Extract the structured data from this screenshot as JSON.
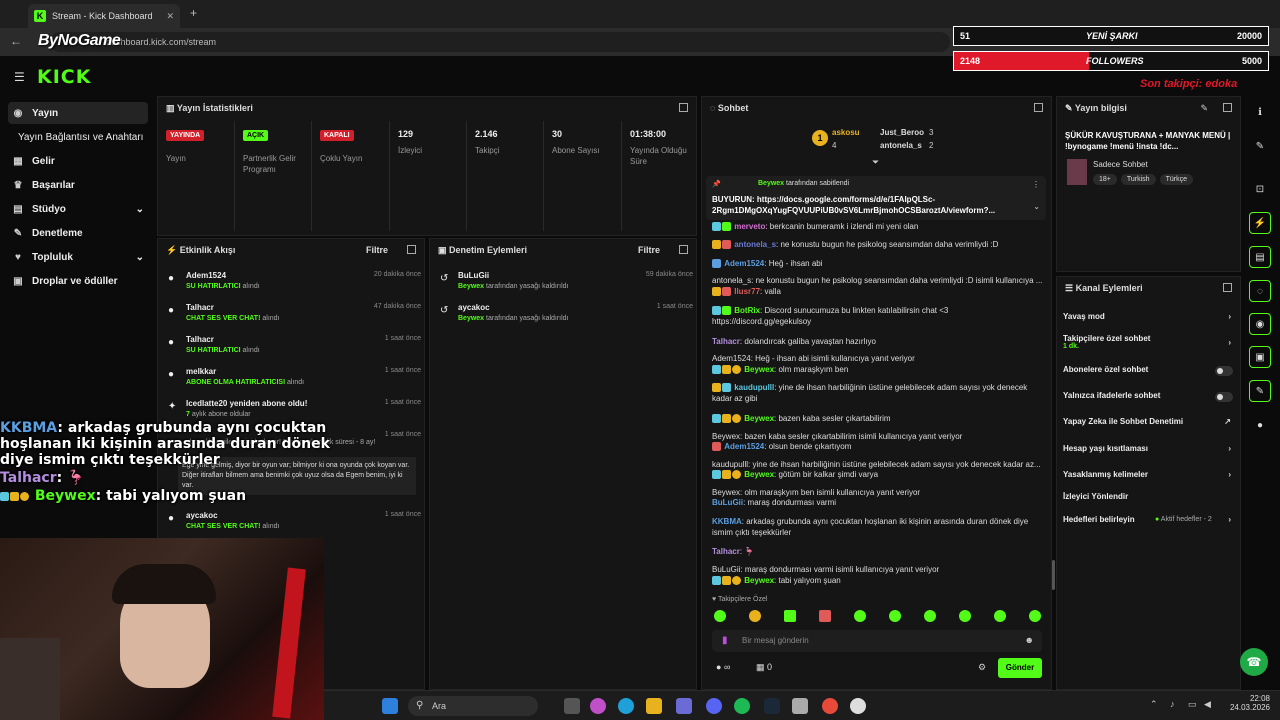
{
  "browser": {
    "tab_title": "Stream - Kick Dashboard",
    "url": "dashboard.kick.com/stream"
  },
  "kick": {
    "logo": "KICK"
  },
  "overlay": {
    "watermark": "ByNoGame",
    "song_current": "51",
    "song_label": "YENİ ŞARKI",
    "song_goal": "20000",
    "followers_current": "2148",
    "followers_label": "FOLLOWERS",
    "followers_goal": "5000",
    "followers_progress": 0.43,
    "last_follower": "Son takipçi: edoka",
    "accent": "#e0192a"
  },
  "sidebar": {
    "items": [
      {
        "label": "Yayın",
        "icon": "broadcast-icon"
      },
      {
        "label": "Yayın Bağlantısı ve Anahtarı",
        "icon": ""
      },
      {
        "label": "Gelir",
        "icon": "revenue-icon"
      },
      {
        "label": "Başarılar",
        "icon": "trophy-icon"
      },
      {
        "label": "Stüdyo",
        "icon": "studio-icon"
      },
      {
        "label": "Denetleme",
        "icon": "wrench-icon"
      },
      {
        "label": "Topluluk",
        "icon": "community-icon"
      },
      {
        "label": "Droplar ve ödüller",
        "icon": "drops-icon"
      }
    ]
  },
  "stats": {
    "title": "Yayın İstatistikleri",
    "cells": [
      {
        "badge": "YAYINDA",
        "label": "Yayın"
      },
      {
        "badge": "AÇIK",
        "label": "Partnerlik Gelir Programı"
      },
      {
        "badge": "KAPALI",
        "label": "Çoklu Yayın"
      },
      {
        "value": "129",
        "label": "İzleyici"
      },
      {
        "value": "2.146",
        "label": "Takipçi"
      },
      {
        "value": "30",
        "label": "Abone Sayısı"
      },
      {
        "value": "01:38:00",
        "label": "Yayında Olduğu Süre"
      }
    ]
  },
  "activity": {
    "title": "Etkinlik Akışı",
    "filter": "Filtre",
    "items": [
      {
        "name": "Adem1524",
        "action": "SU HATIRLATICI",
        "suffix": "alındı",
        "time": "20 dakika önce"
      },
      {
        "name": "Talhacr",
        "action": "CHAT SES VER CHAT!",
        "suffix": "alındı",
        "time": "47 dakika önce"
      },
      {
        "name": "Talhacr",
        "action": "SU HATIRLATICI",
        "suffix": "alındı",
        "time": "1 saat önce"
      },
      {
        "name": "melkkar",
        "action": "ABONE OLMA HATIRLATICISI",
        "suffix": "alındı",
        "time": "1 saat önce"
      },
      {
        "name": "Icedlatte20 yeniden abone oldu!",
        "action": "7",
        "suffix": "aylık abone oldular",
        "time": "1 saat önce"
      },
      {
        "name": "",
        "action": "",
        "suffix": "abonelik yenilemesini kutluyor! Toplam abonelik süresi - 8 ay!",
        "time": "1 saat önce"
      },
      {
        "name": "aycakoc",
        "action": "CHAT SES VER CHAT!",
        "suffix": "alındı",
        "time": "1 saat önce"
      }
    ],
    "message": "Ege yine gelmiş, diyor bir oyun var; bilmiyor ki ona oyunda çok koyan var. Diğer itirafları bilmem ama benimki çok uyuz olsa da Egem benim, iyi ki var."
  },
  "moderation": {
    "title": "Denetim Eylemleri",
    "filter": "Filtre",
    "items": [
      {
        "name": "BuLuGii",
        "by": "Beywex",
        "action": "tarafından yasağı kaldırıldı",
        "time": "59 dakika önce"
      },
      {
        "name": "aycakoc",
        "by": "Beywex",
        "action": "tarafından yasağı kaldırıldı",
        "time": "1 saat önce"
      }
    ]
  },
  "chat": {
    "title": "Sohbet",
    "top": [
      {
        "name": "askosu",
        "count": "4"
      },
      {
        "name": "Just_Beroo",
        "count": "3"
      },
      {
        "name": "antonela_s",
        "count": "2"
      }
    ],
    "pinned_by": "Beywex",
    "pinned_label": "tarafından sabitlendi",
    "pinned_text": "BUYURUN: https://docs.google.com/forms/d/e/1FAIpQLSc-2Rgm1DMgOXqYugFQVUUPiUB0vSV6LmrBjmohOCSBaroztA/viewform?...",
    "messages": [
      {
        "user": "merveto",
        "color": "#d46dd4",
        "text": ": berkcanin bumeramk i izlendi mi yeni olan"
      },
      {
        "user": "antonela_s",
        "color": "#6b7bd6",
        "text": ": ne konustu bugun he psikolog seansımdan daha verimliydi :D"
      },
      {
        "user": "Adem1524",
        "color": "#5b9fe0",
        "text": ": Heğ - ihsan abi"
      },
      {
        "reply": "antonela_s: ne konustu bugun he psikolog seansımdan daha verimliydi :D isimli kullanıcıya ..."
      },
      {
        "user": "Ilusr77",
        "color": "#e05a5a",
        "text": ": valla"
      },
      {
        "user": "BotRix",
        "color": "#53fc18",
        "text": ": Discord sunucumuza bu linkten katılabilirsin chat <3 https://discord.gg/egekulsoy"
      },
      {
        "user": "Talhacr",
        "color": "#b38de0",
        "text": ": dolandırcak galiba yavaştan hazırlıyo"
      },
      {
        "reply": "Adem1524: Heğ - ihsan abi isimli kullanıcıya yanıt veriyor"
      },
      {
        "user": "Beywex",
        "color": "#53fc18",
        "text": ": olm maraşkyım ben"
      },
      {
        "user": "kaudupulll",
        "color": "#5bc8e0",
        "text": ": yine de ihsan harbiliğinin üstüne gelebilecek adam sayısı yok denecek kadar az gibi"
      },
      {
        "user": "Beywex",
        "color": "#53fc18",
        "text": ": bazen kaba sesler çıkartabilirim"
      },
      {
        "reply": "Beywex: bazen kaba sesler çıkartabilirim isimli kullanıcıya yanıt veriyor"
      },
      {
        "user": "Adem1524",
        "color": "#5b9fe0",
        "text": ": olsun bende çıkartıyom"
      },
      {
        "reply": "kaudupulll: yine de ihsan harbiliğinin üstüne gelebilecek adam sayısı yok denecek kadar az..."
      },
      {
        "user": "Beywex",
        "color": "#53fc18",
        "text": ": götüm bir kalkar şimdi varya"
      },
      {
        "reply": "Beywex: olm maraşkyım ben isimli kullanıcıya yanıt veriyor"
      },
      {
        "user": "BuLuGii",
        "color": "#5b9fe0",
        "text": ": maraş dondurması varmi"
      },
      {
        "user": "KKBMA",
        "color": "#5b9fe0",
        "text": ": arkadaş grubunda aynı çocuktan hoşlanan iki kişinin arasında duran dönek diye ismim çıktı teşekkürler"
      },
      {
        "user": "Talhacr",
        "color": "#b38de0",
        "text": ": 🦩"
      },
      {
        "reply": "BuLuGii: maraş dondurması varmi isimli kullanıcıya yanıt veriyor"
      },
      {
        "user": "Beywex",
        "color": "#53fc18",
        "text": ": tabi yalıyom şuan"
      }
    ],
    "followers_only": "Takipçilere Özel",
    "placeholder": "Bir mesaj gönderin",
    "points": "∞",
    "gifts": "0",
    "send": "Gönder"
  },
  "stream_info": {
    "title": "Yayın bilgisi",
    "stream_title": "ŞÜKÜR KAVUŞTURANA + MANYAK MENÜ | !bynogame !menü !insta !dc...",
    "category": "Sadece Sohbet",
    "tags": [
      "18+",
      "Turkish",
      "Türkçe"
    ]
  },
  "channel_actions": {
    "title": "Kanal Eylemleri",
    "items": [
      {
        "label": "Yavaş mod",
        "type": "chevron"
      },
      {
        "label": "Takipçilere özel sohbet",
        "sub": "1 dk.",
        "type": "chevron"
      },
      {
        "label": "Abonelere özel sohbet",
        "type": "toggle"
      },
      {
        "label": "Yalnızca ifadelerle sohbet",
        "type": "toggle"
      },
      {
        "label": "Yapay Zeka ile Sohbet Denetimi",
        "type": "link"
      },
      {
        "label": "Hesap yaşı kısıtlaması",
        "type": "chevron"
      },
      {
        "label": "Yasaklanmış kelimeler",
        "type": "chevron"
      },
      {
        "label": "İzleyici Yönlendir",
        "type": "none"
      },
      {
        "label": "Hedefleri belirleyin",
        "sub": "Aktif hedefler - 2",
        "type": "chevron"
      }
    ]
  },
  "stream_overlay_chat": [
    {
      "user": "KKBMA",
      "color": "#5b9fe0",
      "text": ": arkadaş grubunda aynı çocuktan hoşlanan iki kişinin arasında duran dönek diye ismim çıktı teşekkürler"
    },
    {
      "user": "Talhacr",
      "color": "#b38de0",
      "text": ": 🦩"
    },
    {
      "user": "Beywex",
      "color": "#53fc18",
      "text": ": tabi yalıyom şuan"
    }
  ],
  "taskbar": {
    "search": "Ara",
    "time": "22:08",
    "date": "24.03.2026"
  }
}
